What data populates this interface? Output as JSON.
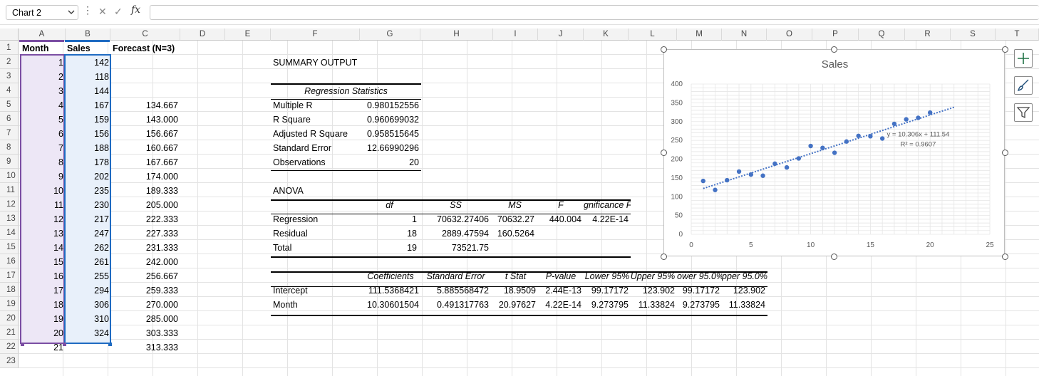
{
  "formula_bar": {
    "name_box": "Chart 2",
    "fx_label": "fx",
    "formula_value": ""
  },
  "columns": [
    "A",
    "B",
    "C",
    "D",
    "E",
    "F",
    "G",
    "H",
    "I",
    "J",
    "K",
    "L",
    "M",
    "N",
    "O",
    "P",
    "Q",
    "R",
    "S",
    "T"
  ],
  "rows": [
    "1",
    "2",
    "3",
    "4",
    "5",
    "6",
    "7",
    "8",
    "9",
    "10",
    "11",
    "12",
    "13",
    "14",
    "15",
    "16",
    "17",
    "18",
    "19",
    "20",
    "21",
    "22",
    "23"
  ],
  "headers": {
    "month": "Month",
    "sales": "Sales",
    "forecast": "Forecast (N=3)"
  },
  "months": [
    "1",
    "2",
    "3",
    "4",
    "5",
    "6",
    "7",
    "8",
    "9",
    "10",
    "11",
    "12",
    "13",
    "14",
    "15",
    "16",
    "17",
    "18",
    "19",
    "20",
    "21"
  ],
  "sales": [
    "142",
    "118",
    "144",
    "167",
    "159",
    "156",
    "188",
    "178",
    "202",
    "235",
    "230",
    "217",
    "247",
    "262",
    "261",
    "255",
    "294",
    "306",
    "310",
    "324"
  ],
  "forecast": [
    "",
    "",
    "",
    "134.667",
    "143.000",
    "156.667",
    "160.667",
    "167.667",
    "174.000",
    "189.333",
    "205.000",
    "222.333",
    "227.333",
    "231.333",
    "242.000",
    "256.667",
    "259.333",
    "270.000",
    "285.000",
    "303.333",
    "313.333"
  ],
  "summary": {
    "title": "SUMMARY OUTPUT",
    "reg_stats_header": "Regression Statistics",
    "reg_stats": [
      {
        "label": "Multiple R",
        "value": "0.980152556"
      },
      {
        "label": "R Square",
        "value": "0.960699032"
      },
      {
        "label": "Adjusted R Square",
        "value": "0.958515645"
      },
      {
        "label": "Standard Error",
        "value": "12.66990296"
      },
      {
        "label": "Observations",
        "value": "20"
      }
    ],
    "anova_title": "ANOVA",
    "anova_headers": [
      "df",
      "SS",
      "MS",
      "F",
      "gnificance F"
    ],
    "anova_rows": [
      {
        "label": "Regression",
        "df": "1",
        "ss": "70632.27406",
        "ms": "70632.27",
        "f": "440.004",
        "sig": "4.22E-14"
      },
      {
        "label": "Residual",
        "df": "18",
        "ss": "2889.47594",
        "ms": "160.5264",
        "f": "",
        "sig": ""
      },
      {
        "label": "Total",
        "df": "19",
        "ss": "73521.75",
        "ms": "",
        "f": "",
        "sig": ""
      }
    ],
    "coef_headers": [
      "Coefficients",
      "Standard Error",
      "t Stat",
      "P-value",
      "Lower 95%",
      "Upper 95%",
      "ower 95.0%",
      "pper 95.0%"
    ],
    "coef_rows": [
      {
        "label": "Intercept",
        "values": [
          "111.5368421",
          "5.885568472",
          "18.9509",
          "2.44E-13",
          "99.17172",
          "123.902",
          "99.17172",
          "123.902"
        ]
      },
      {
        "label": "Month",
        "values": [
          "10.30601504",
          "0.491317763",
          "20.97627",
          "4.22E-14",
          "9.273795",
          "11.33824",
          "9.273795",
          "11.33824"
        ]
      }
    ]
  },
  "chart_data": {
    "type": "scatter",
    "title": "Sales",
    "x": [
      1,
      2,
      3,
      4,
      5,
      6,
      7,
      8,
      9,
      10,
      11,
      12,
      13,
      14,
      15,
      16,
      17,
      18,
      19,
      20
    ],
    "series": [
      {
        "values": [
          142,
          118,
          144,
          167,
          159,
          156,
          188,
          178,
          202,
          235,
          230,
          217,
          247,
          262,
          261,
          255,
          294,
          306,
          310,
          324
        ]
      }
    ],
    "trendline": {
      "slope": 10.306,
      "intercept": 111.54,
      "equation": "y = 10.306x + 111.54",
      "r2": "R² = 0.9607"
    },
    "xlim": [
      0,
      25
    ],
    "ylim": [
      0,
      400
    ],
    "x_ticks": [
      "0",
      "5",
      "10",
      "15",
      "20",
      "25"
    ],
    "y_ticks": [
      "0",
      "50",
      "100",
      "150",
      "200",
      "250",
      "300",
      "350",
      "400"
    ],
    "grid": true,
    "point_color": "#4472c4"
  },
  "colors": {
    "month_fill": "#ede7f6",
    "sales_fill": "#e8f0fa",
    "month_border": "#7b4ea3",
    "sales_border": "#1f6bc2",
    "accent_green": "#217346"
  },
  "side_buttons": [
    "chart-elements-icon",
    "chart-styles-icon",
    "chart-filters-icon"
  ]
}
